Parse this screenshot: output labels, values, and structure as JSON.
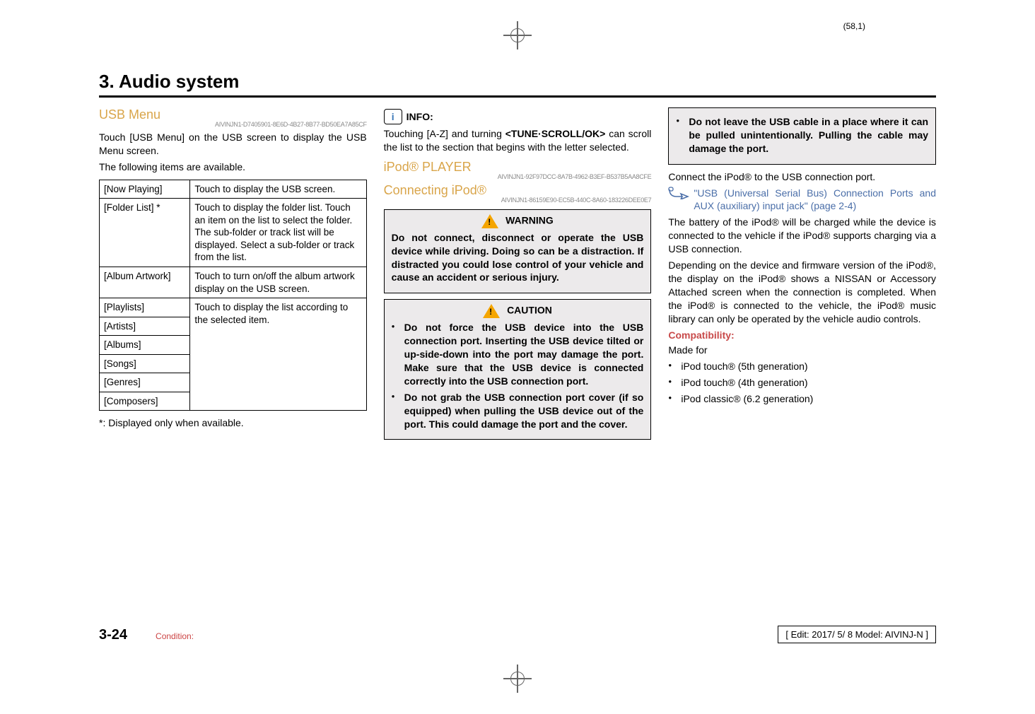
{
  "page_num_top": "(58,1)",
  "section_title": "3. Audio system",
  "col1": {
    "heading": "USB Menu",
    "guid": "AIVINJN1-D7405901-8E6D-4B27-8B77-BD50EA7A85CF",
    "p1a": "Touch [USB Menu] on the USB screen to display the USB Menu screen.",
    "p1b": "The following items are available.",
    "table": [
      {
        "name": "[Now Playing]",
        "desc": "Touch to display the USB screen."
      },
      {
        "name": "[Folder List] *",
        "desc": "Touch to display the folder list. Touch an item on the list to select the folder.\nThe sub-folder or track list will be displayed. Select a sub-folder or track from the list."
      },
      {
        "name": "[Album Artwork]",
        "desc": "Touch to turn on/off the album artwork display on the USB screen."
      },
      {
        "name": "[Playlists]",
        "desc_shared": "Touch to display the list according to the selected item."
      },
      {
        "name": "[Artists]"
      },
      {
        "name": "[Albums]"
      },
      {
        "name": "[Songs]"
      },
      {
        "name": "[Genres]"
      },
      {
        "name": "[Composers]"
      }
    ],
    "foot": "*: Displayed only when available."
  },
  "col2": {
    "info_label": "INFO:",
    "info_p_a": "Touching [A-Z] and turning ",
    "info_bold": "<TUNE·SCROLL/OK>",
    "info_p_b": " can scroll the list to the section that begins with the letter selected.",
    "h_player": "iPod® PLAYER",
    "guid_player": "AIVINJN1-92F97DCC-8A7B-4962-B3EF-B537B5AA8CFE",
    "h_connect": "Connecting iPod®",
    "guid_connect": "AIVINJN1-86159E90-EC5B-440C-8A60-183226DEE0E7",
    "warn_title": "WARNING",
    "warn_body": "Do not connect, disconnect or operate the USB device while driving. Doing so can be a distraction. If distracted you could lose control of your vehicle and cause an accident or serious injury.",
    "caut_title": "CAUTION",
    "caut_items": [
      "Do not force the USB device into the USB connection port. Inserting the USB device tilted or up-side-down into the port may damage the port. Make sure that the USB device is connected correctly into the USB connection port.",
      "Do not grab the USB connection port cover (if so equipped) when pulling the USB device out of the port. This could damage the port and the cover."
    ]
  },
  "col3": {
    "caut_cont": [
      "Do not leave the USB cable in a place where it can be pulled unintentionally. Pulling the cable may damage the port."
    ],
    "p_connect": "Connect the iPod® to the USB connection port.",
    "xref": "\"USB (Universal Serial Bus) Connection Ports and AUX (auxiliary) input jack\" (page 2-4)",
    "p_battery": "The battery of the iPod® will be charged while the device is connected to the vehicle if the iPod® supports charging via a USB connection.",
    "p_depending": "Depending on the device and firmware version of the iPod®, the display on the iPod® shows a NISSAN or Accessory Attached screen when the connection is completed. When the iPod® is connected to the vehicle, the iPod® music library can only be operated by the vehicle audio controls.",
    "compat_head": "Compatibility:",
    "made_for": "Made for",
    "compat_items": [
      "iPod touch® (5th generation)",
      "iPod touch® (4th generation)",
      "iPod classic® (6.2 generation)"
    ]
  },
  "footer": {
    "pg": "3-24",
    "condition": "Condition:",
    "edit": "[ Edit: 2017/ 5/ 8    Model:  AIVINJ-N ]"
  }
}
